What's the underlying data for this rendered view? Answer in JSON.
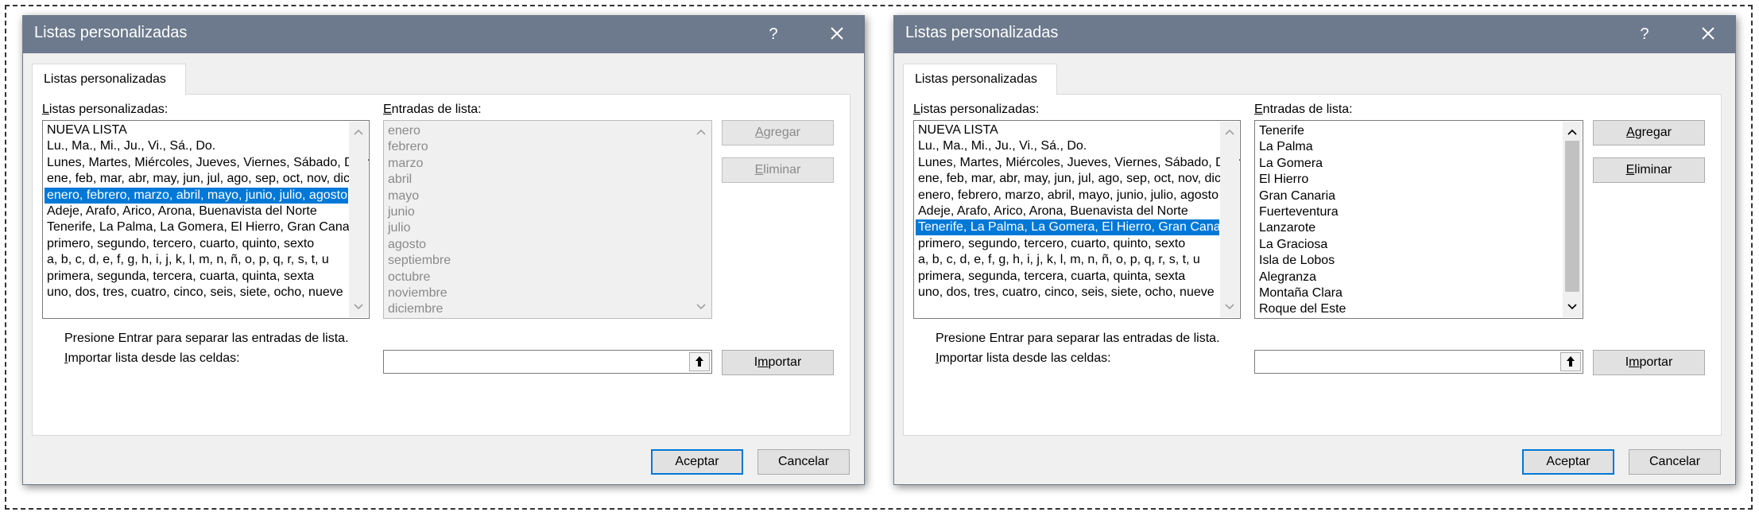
{
  "dialogs": [
    {
      "title": "Listas personalizadas",
      "help": "?",
      "tab": "Listas personalizadas",
      "lists_label": "Listas personalizadas:",
      "entries_label": "Entradas de lista:",
      "lists": [
        "NUEVA LISTA",
        "Lu., Ma., Mi., Ju., Vi., Sá., Do.",
        "Lunes, Martes, Miércoles, Jueves, Viernes, Sábado, Domingo",
        "ene, feb, mar, abr, may, jun, jul, ago, sep, oct, nov, dic",
        "enero, febrero, marzo, abril, mayo, junio, julio, agosto",
        "Adeje, Arafo, Arico, Arona, Buenavista del Norte",
        "Tenerife, La Palma, La Gomera, El Hierro, Gran Canaria",
        "primero, segundo, tercero, cuarto, quinto, sexto",
        "a, b, c, d, e, f, g, h, i, j, k, l, m, n, ñ, o, p, q, r, s, t, u",
        "primera, segunda, tercera, cuarta, quinta, sexta",
        "uno, dos, tres, cuatro, cinco, seis, siete, ocho, nueve"
      ],
      "selected_index": 4,
      "entries": [
        "enero",
        "febrero",
        "marzo",
        "abril",
        "mayo",
        "junio",
        "julio",
        "agosto",
        "septiembre",
        "octubre",
        "noviembre",
        "diciembre"
      ],
      "entries_enabled": false,
      "add_label": "Agregar",
      "delete_label": "Eliminar",
      "buttons_enabled": false,
      "hint": "Presione Entrar para separar las entradas de lista.",
      "import_label": "Importar lista desde las celdas:",
      "import_value": "",
      "import_button": "Importar",
      "ok_label": "Aceptar",
      "cancel_label": "Cancelar"
    },
    {
      "title": "Listas personalizadas",
      "help": "?",
      "tab": "Listas personalizadas",
      "lists_label": "Listas personalizadas:",
      "entries_label": "Entradas de lista:",
      "lists": [
        "NUEVA LISTA",
        "Lu., Ma., Mi., Ju., Vi., Sá., Do.",
        "Lunes, Martes, Miércoles, Jueves, Viernes, Sábado, Domingo",
        "ene, feb, mar, abr, may, jun, jul, ago, sep, oct, nov, dic",
        "enero, febrero, marzo, abril, mayo, junio, julio, agosto",
        "Adeje, Arafo, Arico, Arona, Buenavista del Norte",
        "Tenerife, La Palma, La Gomera, El Hierro, Gran Canaria",
        "primero, segundo, tercero, cuarto, quinto, sexto",
        "a, b, c, d, e, f, g, h, i, j, k, l, m, n, ñ, o, p, q, r, s, t, u",
        "primera, segunda, tercera, cuarta, quinta, sexta",
        "uno, dos, tres, cuatro, cinco, seis, siete, ocho, nueve"
      ],
      "selected_index": 6,
      "entries": [
        "Tenerife",
        "La Palma",
        "La Gomera",
        "El Hierro",
        "Gran Canaria",
        "Fuerteventura",
        "Lanzarote",
        "La Graciosa",
        "Isla de Lobos",
        "Alegranza",
        "Montaña Clara",
        "Roque del Este"
      ],
      "entries_enabled": true,
      "add_label": "Agregar",
      "delete_label": "Eliminar",
      "buttons_enabled": true,
      "hint": "Presione Entrar para separar las entradas de lista.",
      "import_label": "Importar lista desde las celdas:",
      "import_value": "",
      "import_button": "Importar",
      "ok_label": "Aceptar",
      "cancel_label": "Cancelar"
    }
  ],
  "icons": {
    "close": "close-icon",
    "collapse": "collapse-dialog-icon",
    "scroll_up": "chevron-up-icon",
    "scroll_down": "chevron-down-icon"
  },
  "colors": {
    "titlebar": "#6d7a8d",
    "selection": "#0078d7",
    "dialog_bg": "#f0f0f0"
  }
}
